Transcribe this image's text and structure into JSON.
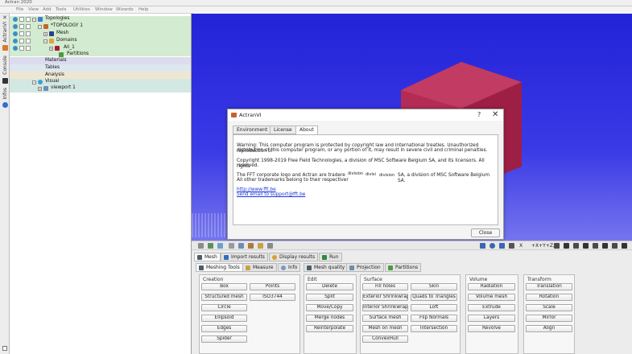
{
  "window": {
    "title": "Actran 2020"
  },
  "menu": [
    "File",
    "View",
    "Add",
    "Tools",
    "Utilities",
    "Window",
    "Wizards",
    "Help"
  ],
  "side_tabs": [
    "ActranVI",
    "Console",
    "Infos"
  ],
  "tree": {
    "topologies": "Topologies",
    "topology1": "*TOPOLOGY 1",
    "mesh": "Mesh",
    "domains": "Domains",
    "all1": "All_1",
    "partitions": "Partitions",
    "materials": "Materials",
    "tables": "Tables",
    "analysis": "Analysis",
    "visual": "Visual",
    "viewport1": "viewport 1"
  },
  "dialog": {
    "title": "ActranVI",
    "help": "?",
    "close_icon": "✕",
    "tabs": [
      "Environment",
      "License",
      "About"
    ],
    "active_tab": "About",
    "warning_line1": "Warning: This computer program is protected by copyright law and international treaties. Unauthorized reproduction or",
    "warning_line2": "distribution of this computer program, or any portion of it, may result in severe civil and criminal penalties.",
    "copyright_line1": "Copyright 1998-2019 Free Field Technologies, a division of MSC Software Belgium SA, and its licensors. All rights",
    "copyright_line2": "reserved.",
    "trademark_line1": "The FFT corporate logo and Actran are tradere",
    "trademark_overlap1": "division",
    "trademark_overlap2": "divisi",
    "trademark_overlap3": "division",
    "trademark_line1b": "SA, a division of MSC Software Belgium SA.",
    "trademark_line2": "All other trademarks belong to their respectiver",
    "link1": "http://www.fft.be",
    "link2": "Send email to support@fft.be",
    "close_button": "Close"
  },
  "view_toolbar": {
    "x_label": "X",
    "axes_label": "+X+Y+Z,"
  },
  "panel": {
    "main_tabs": [
      "Mesh",
      "Import results",
      "Display results",
      "Run"
    ],
    "sub_tabs": [
      "Meshing Tools",
      "Measure",
      "Info",
      "Mesh quality",
      "Projection",
      "Partitions"
    ],
    "groups": {
      "creation": {
        "title": "Creation",
        "buttons": [
          "Box",
          "Points",
          "Structured mesh",
          "ISO3744",
          "Circle",
          "Ellipsoid",
          "Edges",
          "Spider"
        ]
      },
      "edit": {
        "title": "Edit",
        "buttons": [
          "Delete",
          "Split",
          "Move/Copy",
          "Merge nodes",
          "Reinterpolate"
        ]
      },
      "surface": {
        "title": "Surface",
        "buttons": [
          "Fill holes",
          "Skin",
          "Exterior Shrinkwrap",
          "Quads to Triangles",
          "Interior Shrinkwrap",
          "Loft",
          "Surface mesh",
          "Flip Normals",
          "Mesh on mesh",
          "Intersection",
          "ConvexHull"
        ]
      },
      "volume": {
        "title": "Volume",
        "buttons": [
          "Radiation",
          "Volume mesh",
          "Extrude",
          "Layers",
          "Revolve"
        ]
      },
      "transform": {
        "title": "Transform",
        "buttons": [
          "Translation",
          "Rotation",
          "Scale",
          "Mirror",
          "Align"
        ]
      }
    }
  },
  "colors": {
    "viewport": "#2a2ae0",
    "cube": "#b2244a",
    "tree_highlight": "#cfe8cf",
    "link": "#1a35d8"
  }
}
